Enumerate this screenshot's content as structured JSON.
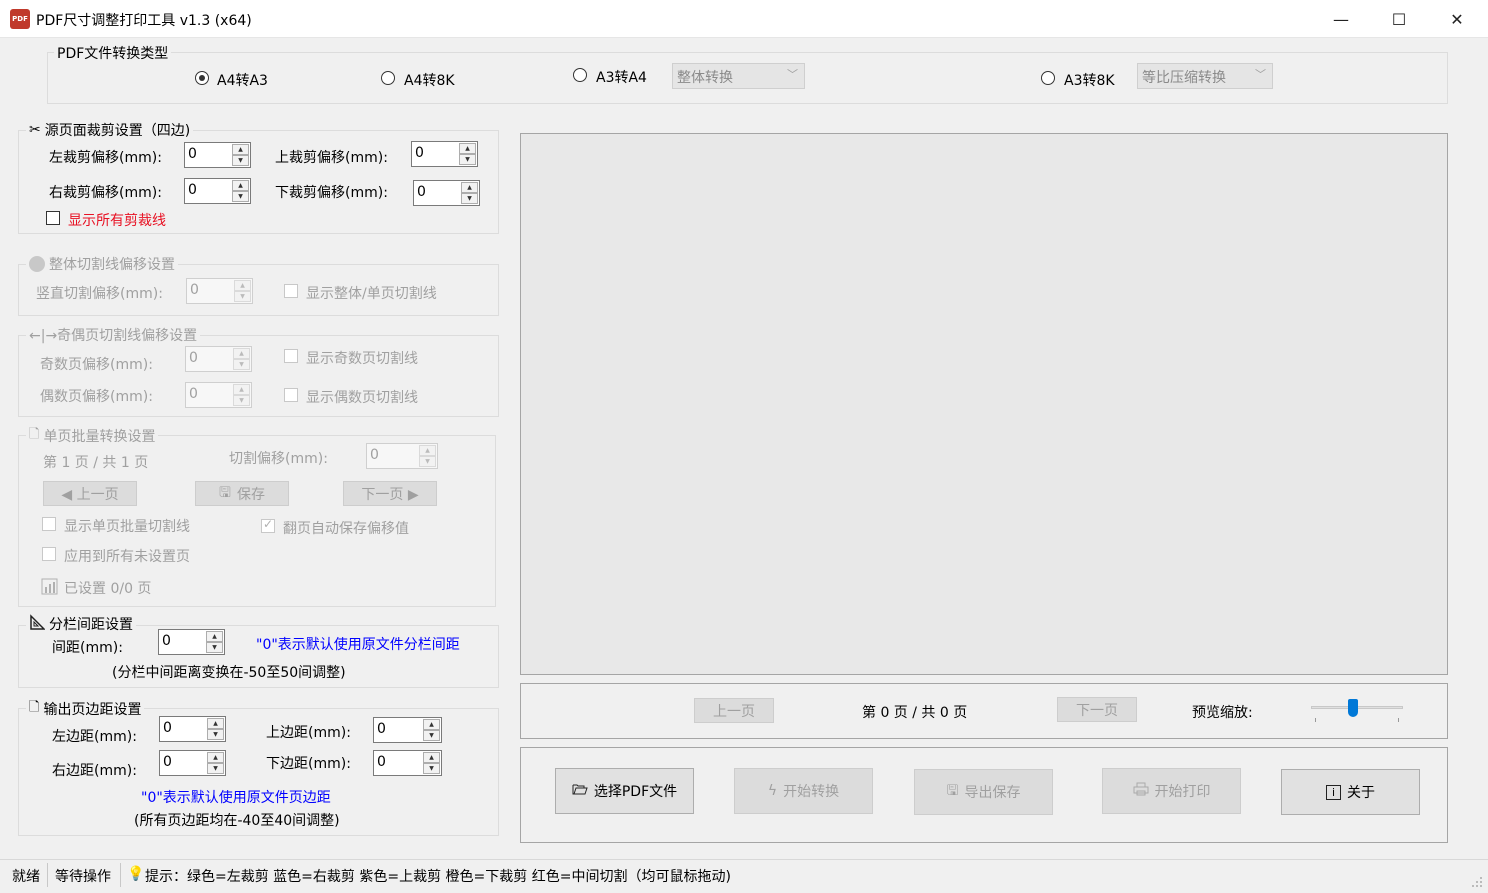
{
  "window": {
    "title": "PDF尺寸调整打印工具 v1.3  (x64)",
    "icon_text": "PDF",
    "minimize": "—",
    "maximize": "☐",
    "close": "✕"
  },
  "convert_type": {
    "label": "PDF文件转换类型",
    "options": [
      "A4转A3",
      "A4转8K",
      "A3转A4",
      "A3转8K"
    ],
    "selected": "A4转A3",
    "a3a4_mode": "整体转换",
    "a38k_mode": "等比压缩转换"
  },
  "crop": {
    "label": "源页面裁剪设置（四边)",
    "left_label": "左裁剪偏移(mm):",
    "left_value": "0",
    "top_label": "上裁剪偏移(mm):",
    "top_value": "0",
    "right_label": "右裁剪偏移(mm):",
    "right_value": "0",
    "bottom_label": "下裁剪偏移(mm):",
    "bottom_value": "0",
    "show_lines": "显示所有剪裁线"
  },
  "whole_cut": {
    "label": "整体切割线偏移设置",
    "vertical_label": "竖直切割偏移(mm):",
    "vertical_value": "0",
    "show_lines": "显示整体/单页切割线"
  },
  "odd_even": {
    "label": "←|→奇偶页切割线偏移设置",
    "odd_label": "奇数页偏移(mm):",
    "odd_value": "0",
    "even_label": "偶数页偏移(mm):",
    "even_value": "0",
    "show_odd": "显示奇数页切割线",
    "show_even": "显示偶数页切割线"
  },
  "single_batch": {
    "label": "单页批量转换设置",
    "page_info": "第 1 页 / 共 1 页",
    "offset_label": "切割偏移(mm):",
    "offset_value": "0",
    "prev": "◀ 上一页",
    "save": "保存",
    "next": "下一页 ▶",
    "show_batch_lines": "显示单页批量切割线",
    "auto_save": "翻页自动保存偏移值",
    "apply_all": "应用到所有未设置页",
    "set_count": "已设置 0/0 页"
  },
  "column_gap": {
    "label": "分栏间距设置",
    "gap_label": "间距(mm):",
    "gap_value": "0",
    "hint": "\"0\"表示默认使用原文件分栏间距",
    "range": "(分栏中间距离变换在-50至50间调整)"
  },
  "margins": {
    "label": "输出页边距设置",
    "left_label": "左边距(mm):",
    "left_value": "0",
    "top_label": "上边距(mm):",
    "top_value": "0",
    "right_label": "右边距(mm):",
    "right_value": "0",
    "bottom_label": "下边距(mm):",
    "bottom_value": "0",
    "hint": "\"0\"表示默认使用原文件页边距",
    "range": "(所有页边距均在-40至40间调整)"
  },
  "preview_nav": {
    "prev": "上一页",
    "page_info": "第 0 页 / 共 0 页",
    "next": "下一页",
    "zoom_label": "预览缩放:",
    "zoom_level": 0.45
  },
  "actions": {
    "select": "选择PDF文件",
    "convert": "开始转换",
    "export": "导出保存",
    "print": "开始打印",
    "about": "关于"
  },
  "status": {
    "ready": "就绪",
    "waiting": "等待操作",
    "hint": "提示：绿色=左裁剪 蓝色=右裁剪 紫色=上裁剪 橙色=下裁剪 红色=中间切割（均可鼠标拖动)"
  }
}
